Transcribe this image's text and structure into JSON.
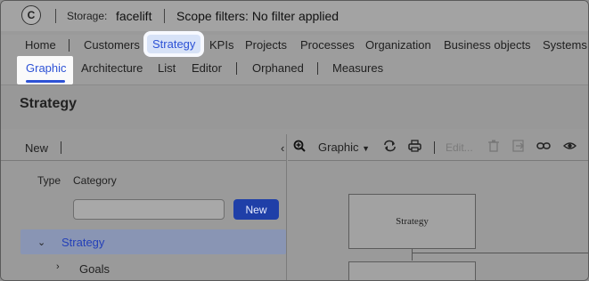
{
  "topbar": {
    "logo_letter": "C",
    "storage_label": "Storage:",
    "storage_value": "facelift",
    "scope_text": "Scope filters: No filter applied"
  },
  "nav_primary": {
    "items": [
      "Home",
      "Customers",
      "Strategy",
      "KPIs",
      "Projects",
      "Processes",
      "Organization",
      "Business objects",
      "Systems"
    ],
    "active": "Strategy"
  },
  "nav_secondary": {
    "items": [
      "Graphic",
      "Architecture",
      "List",
      "Editor",
      "Orphaned",
      "Measures"
    ],
    "active": "Graphic"
  },
  "page": {
    "title": "Strategy"
  },
  "left_panel": {
    "new_label": "New",
    "type_label": "Type",
    "category_label": "Category",
    "category_value": "",
    "new_button": "New",
    "tree": [
      {
        "label": "Strategy",
        "expanded": true,
        "selected": true
      },
      {
        "label": "Goals",
        "expanded": false,
        "selected": false
      }
    ]
  },
  "right_panel": {
    "view_dropdown": "Graphic",
    "edit_label": "Edit...",
    "icons": [
      "zoom-in-icon",
      "refresh-icon",
      "print-icon",
      "delete-icon",
      "export-icon",
      "link-icon",
      "eye-icon"
    ],
    "nodes": [
      {
        "label": "Strategy"
      },
      {
        "label": ""
      }
    ]
  },
  "colors": {
    "accent": "#2d52d6",
    "button_bg": "#1f3fa8"
  }
}
